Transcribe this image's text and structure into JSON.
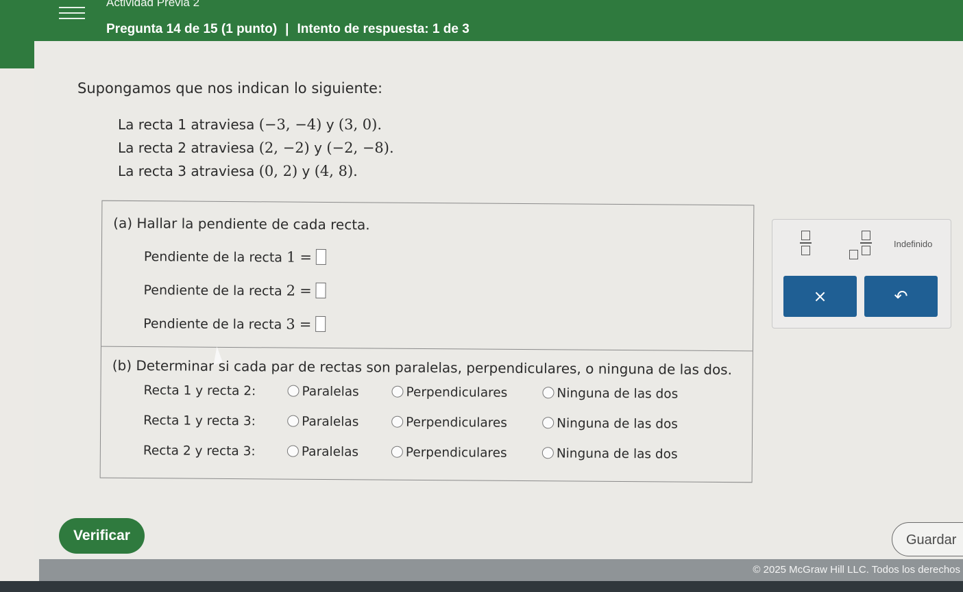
{
  "header": {
    "activity_title": "Actividad Previa 2",
    "question_label": "Pregunta 14 de 15 (1 punto)",
    "separator": "|",
    "attempt_label": "Intento de respuesta: 1 de 3"
  },
  "problem": {
    "intro": "Supongamos que nos indican lo siguiente:",
    "lines": [
      {
        "prefix": "La recta 1 atraviesa",
        "p1": "(−3, −4)",
        "y": "y",
        "p2": "(3, 0)."
      },
      {
        "prefix": "La recta 2 atraviesa",
        "p1": "(2, −2)",
        "y": "y",
        "p2": "(−2, −8)."
      },
      {
        "prefix": "La recta 3 atraviesa",
        "p1": "(0, 2)",
        "y": "y",
        "p2": "(4, 8)."
      }
    ]
  },
  "part_a": {
    "title": "(a) Hallar la pendiente de cada recta.",
    "rows": [
      {
        "label": "Pendiente de la recta",
        "num": "1",
        "eq": "="
      },
      {
        "label": "Pendiente de la recta",
        "num": "2",
        "eq": "="
      },
      {
        "label": "Pendiente de la recta",
        "num": "3",
        "eq": "="
      }
    ]
  },
  "part_b": {
    "title": "(b) Determinar si cada par de rectas son paralelas, perpendiculares, o ninguna de las dos.",
    "options": [
      "Paralelas",
      "Perpendiculares",
      "Ninguna de las dos"
    ],
    "pairs": [
      "Recta 1 y recta 2:",
      "Recta 1 y recta 3:",
      "Recta 2 y recta 3:"
    ]
  },
  "toolbox": {
    "undefined_label": "Indefinido",
    "clear_symbol": "×",
    "undo_symbol": "↶"
  },
  "actions": {
    "verify_label": "Verificar",
    "save_label": "Guardar"
  },
  "footer": {
    "copyright": "© 2025 McGraw Hill LLC. Todos los derechos"
  }
}
